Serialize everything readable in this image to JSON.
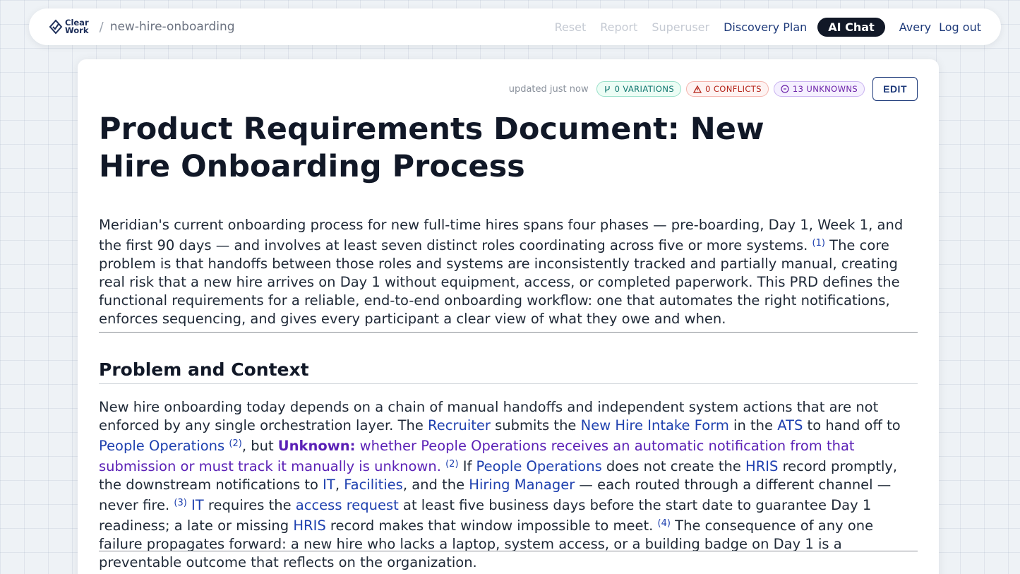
{
  "nav": {
    "logo_line1": "Clear",
    "logo_line2": "Work",
    "separator": "/",
    "breadcrumb": "new-hire-onboarding",
    "links": {
      "reset": "Reset",
      "report": "Report",
      "superuser": "Superuser",
      "discovery_plan": "Discovery Plan",
      "ai_chat": "AI Chat",
      "user": "Avery",
      "logout": "Log out"
    }
  },
  "doc": {
    "updated": "updated just now",
    "badges": {
      "variations": "0 VARIATIONS",
      "conflicts": "0 CONFLICTS",
      "unknowns": "13 UNKNOWNS"
    },
    "edit_label": "EDIT",
    "title": "Product Requirements Document: New Hire Onboarding Process",
    "intro": {
      "a": "Meridian's current onboarding process for new full-time hires spans four phases — pre-boarding, Day 1, Week 1, and the first 90 days — and involves at least seven distinct roles coordinating across five or more systems.",
      "ref1": "(1)",
      "b": " The core problem is that handoffs between those roles and systems are inconsistently tracked and partially manual, creating real risk that a new hire arrives on Day 1 without equipment, access, or completed paperwork. This PRD defines the functional requirements for a reliable, end-to-end onboarding workflow: one that automates the right notifications, enforces sequencing, and gives every participant a clear view of what they owe and when."
    },
    "section": {
      "heading": "Problem and Context",
      "p": {
        "t1": "New hire onboarding today depends on a chain of manual handoffs and independent system actions that are not enforced by any single orchestration layer. The ",
        "e_recruiter": "Recruiter",
        "t2": " submits the ",
        "e_form": "New Hire Intake Form",
        "t3": " in the ",
        "e_ats": "ATS",
        "t4": " to hand off to ",
        "e_people_ops": "People Operations",
        "r2a": "(2)",
        "t5": ", but ",
        "unknown_label": "Unknown:",
        "unknown_text": " whether People Operations receives an automatic notification from that submission or must track it manually is unknown.",
        "r2b": "(2)",
        "t6": " If ",
        "e_people_ops2": "People Operations",
        "t7": " does not create the ",
        "e_hris": "HRIS",
        "t8": " record promptly, the downstream notifications to ",
        "e_it": "IT",
        "t9": ", ",
        "e_facilities": "Facilities",
        "t10": ", and the ",
        "e_hiring_manager": "Hiring Manager",
        "t11": " — each routed through a different channel — never fire.",
        "r3": "(3)",
        "t12": " ",
        "e_it2": "IT",
        "t13": " requires the ",
        "e_access_request": "access request",
        "t14": " at least five business days before the start date to guarantee Day 1 readiness; a late or missing ",
        "e_hris2": "HRIS",
        "t15": " record makes that window impossible to meet.",
        "r4": "(4)",
        "t16": " The consequence of any one failure propagates forward: a new hire who lacks a laptop, system access, or a building badge on Day 1 is a preventable outcome that reflects on the organization."
      }
    }
  }
}
